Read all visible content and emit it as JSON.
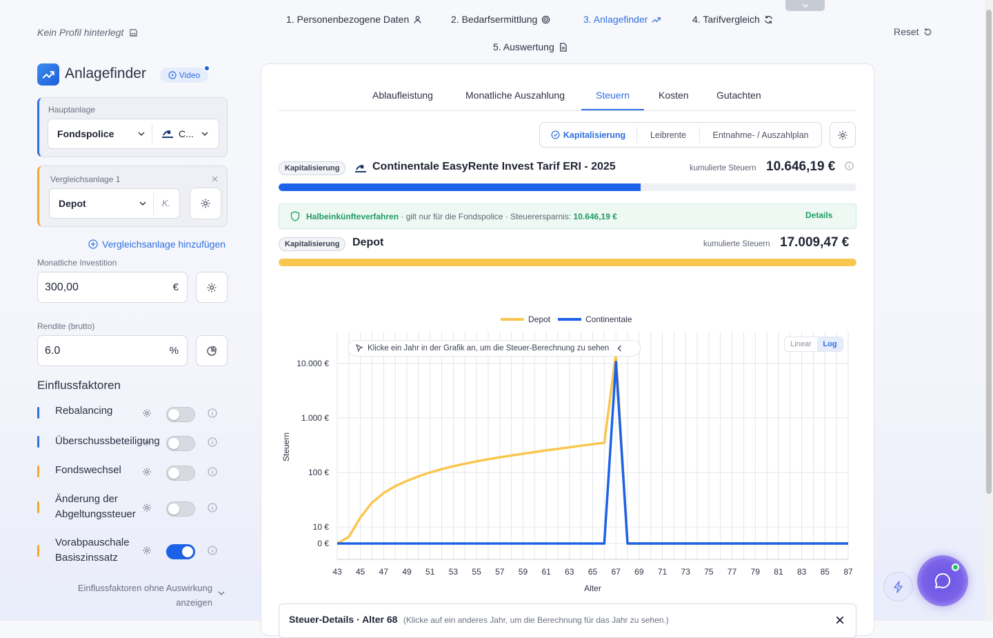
{
  "stepper": {
    "steps": [
      {
        "label": "1. Personenbezogene Daten",
        "icon": "user-icon"
      },
      {
        "label": "2. Bedarfsermittlung",
        "icon": "target-icon"
      },
      {
        "label": "3. Anlagefinder",
        "icon": "trend-icon"
      },
      {
        "label": "4. Tarifvergleich",
        "icon": "refresh-icon"
      },
      {
        "label": "5. Auswertung",
        "icon": "document-icon"
      }
    ],
    "active_index": 2,
    "reset_label": "Reset"
  },
  "profile": {
    "text": "Kein Profil hinterlegt"
  },
  "app": {
    "title": "Anlagefinder",
    "video_label": "Video"
  },
  "hauptanlage": {
    "label": "Hauptanlage",
    "product": "Fondspolice",
    "provider": "C..."
  },
  "vergleichsanlage": {
    "label": "Vergleichsanlage 1",
    "product": "Depot",
    "provider": "K."
  },
  "add_comparison": "Vergleichsanlage hinzufügen",
  "monthly": {
    "label": "Monatliche Investition",
    "value": "300,00",
    "unit": "€"
  },
  "rendite": {
    "label": "Rendite (brutto)",
    "value": "6.0",
    "unit": "%"
  },
  "factors": {
    "title": "Einflussfaktoren",
    "items": [
      {
        "label": "Rebalancing",
        "on": false,
        "color": "#2f6fe0"
      },
      {
        "label": "Überschussbeteiligung",
        "on": false,
        "color": "#2f6fe0"
      },
      {
        "label": "Fondswechsel",
        "on": false,
        "color": "#f0a830"
      },
      {
        "label": "Änderung der Abgeltungssteuer",
        "on": false,
        "color": "#f0a830"
      },
      {
        "label": "Vorabpauschale Basiszinssatz",
        "on": true,
        "color": "#f0a830"
      }
    ],
    "more_link": "Einflussfaktoren ohne Auswirkung anzeigen"
  },
  "tabs": [
    "Ablaufleistung",
    "Monatliche Auszahlung",
    "Steuern",
    "Kosten",
    "Gutachten"
  ],
  "active_tab": "Steuern",
  "segments": [
    "Kapitalisierung",
    "Leibrente",
    "Entnahme- / Auszahlplan"
  ],
  "active_segment": "Kapitalisierung",
  "products": [
    {
      "badge": "Kapitalisierung",
      "name": "Continentale EasyRente Invest Tarif ERI - 2025",
      "kum_label": "kumulierte Steuern",
      "kum_value": "10.646,19 €",
      "color": "#1c62e8",
      "progress": 0.626
    },
    {
      "badge": "Kapitalisierung",
      "name": "Depot",
      "kum_label": "kumulierte Steuern",
      "kum_value": "17.009,47 €",
      "color": "#f9c74f",
      "progress": 1.0
    }
  ],
  "info_box": {
    "title": "Halbeinkünfteverfahren",
    "text": "· gilt nur für die Fondspolice · Steuerersparnis:",
    "amount": "10.646,19 €",
    "details": "Details"
  },
  "chart_hint": "Klicke ein Jahr in der Grafik an, um die Steuer-Berechnung zu sehen",
  "scale_toggle": {
    "linear": "Linear",
    "log": "Log",
    "active": "Log"
  },
  "details_bar": {
    "title": "Steuer-Details · Alter 68",
    "hint": "(Klicke auf ein anderes Jahr, um die Berechnung für das Jahr zu sehen.)"
  },
  "chart_data": {
    "type": "line",
    "xlabel": "Alter",
    "ylabel": "Steuern",
    "yscale": "log",
    "ytick_labels": [
      "0 €",
      "10 €",
      "100 €",
      "1.000 €",
      "10.000 €"
    ],
    "x": [
      43,
      44,
      45,
      46,
      47,
      48,
      49,
      50,
      51,
      52,
      53,
      54,
      55,
      56,
      57,
      58,
      59,
      60,
      61,
      62,
      63,
      64,
      65,
      66,
      67,
      68,
      69,
      70,
      71,
      72,
      73,
      74,
      75,
      76,
      77,
      78,
      79,
      80,
      81,
      82,
      83,
      84,
      85,
      86,
      87
    ],
    "series": [
      {
        "name": "Depot",
        "color": "#f9c74f",
        "values": [
          0,
          4,
          15,
          28,
          42,
          56,
          70,
          85,
          100,
          115,
          130,
          145,
          160,
          175,
          190,
          205,
          220,
          237,
          255,
          270,
          290,
          310,
          330,
          350,
          15000,
          0,
          0,
          0,
          0,
          0,
          0,
          0,
          0,
          0,
          0,
          0,
          0,
          0,
          0,
          0,
          0,
          0,
          0,
          0,
          0
        ]
      },
      {
        "name": "Continentale",
        "color": "#1c62e8",
        "values": [
          0,
          0,
          0,
          0,
          0,
          0,
          0,
          0,
          0,
          0,
          0,
          0,
          0,
          0,
          0,
          0,
          0,
          0,
          0,
          0,
          0,
          0,
          0,
          0,
          10646,
          0,
          0,
          0,
          0,
          0,
          0,
          0,
          0,
          0,
          0,
          0,
          0,
          0,
          0,
          0,
          0,
          0,
          0,
          0,
          0
        ]
      }
    ],
    "legend_position": "top-center",
    "grid": true
  }
}
